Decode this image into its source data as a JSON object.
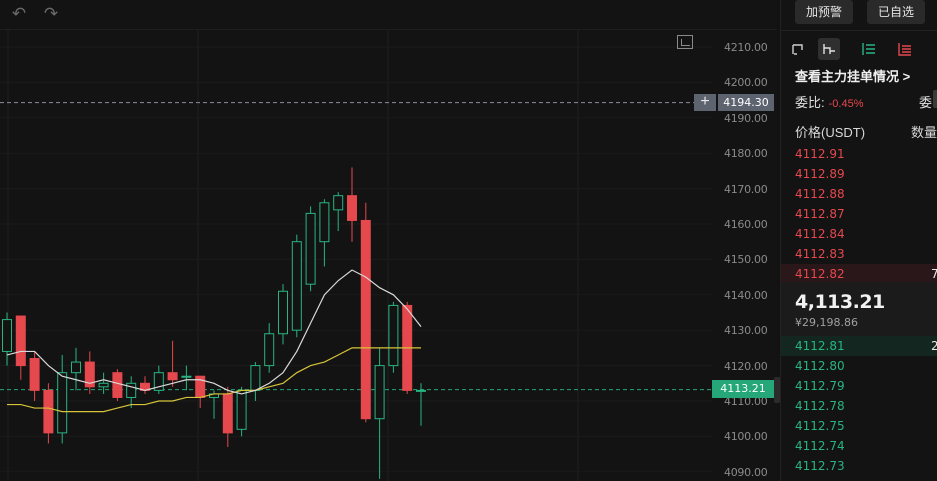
{
  "toolbar": {
    "undo_icon": "undo-icon",
    "redo_icon": "redo-icon",
    "fullscreen_icon": "fullscreen-icon"
  },
  "price_axis": [
    "4210.00",
    "4200.00",
    "4190.00",
    "4180.00",
    "4170.00",
    "4160.00",
    "4150.00",
    "4140.00",
    "4130.00",
    "4120.00",
    "4110.00",
    "4100.00",
    "4090.00"
  ],
  "crosshair": {
    "price": "4194.30",
    "plus_label": "+"
  },
  "last_price_tag": "4113.21",
  "colors": {
    "up": "#28b582",
    "down": "#e5484d",
    "ma_fast": "#d9d9d9",
    "ma_slow": "#d6c43a",
    "price_tag": "#25a779"
  },
  "chart_data": {
    "type": "candlestick",
    "ylim": [
      4087,
      4215
    ],
    "candles": [
      {
        "o": 4124,
        "h": 4135,
        "l": 4120,
        "c": 4133
      },
      {
        "o": 4134,
        "h": 4134,
        "l": 4116,
        "c": 4120
      },
      {
        "o": 4122,
        "h": 4124,
        "l": 4110,
        "c": 4113
      },
      {
        "o": 4113,
        "h": 4115,
        "l": 4098,
        "c": 4101
      },
      {
        "o": 4101,
        "h": 4123,
        "l": 4098,
        "c": 4118
      },
      {
        "o": 4118,
        "h": 4125,
        "l": 4113,
        "c": 4121
      },
      {
        "o": 4121,
        "h": 4124,
        "l": 4112,
        "c": 4114
      },
      {
        "o": 4114,
        "h": 4118,
        "l": 4112,
        "c": 4115
      },
      {
        "o": 4118,
        "h": 4119,
        "l": 4110,
        "c": 4111
      },
      {
        "o": 4111,
        "h": 4117,
        "l": 4108,
        "c": 4115
      },
      {
        "o": 4115,
        "h": 4117,
        "l": 4112,
        "c": 4113
      },
      {
        "o": 4113,
        "h": 4120,
        "l": 4112,
        "c": 4118
      },
      {
        "o": 4118,
        "h": 4127,
        "l": 4114,
        "c": 4116
      },
      {
        "o": 4117,
        "h": 4120,
        "l": 4113,
        "c": 4117
      },
      {
        "o": 4117,
        "h": 4117,
        "l": 4108,
        "c": 4111
      },
      {
        "o": 4111,
        "h": 4113,
        "l": 4105,
        "c": 4112
      },
      {
        "o": 4112,
        "h": 4114,
        "l": 4097,
        "c": 4101
      },
      {
        "o": 4102,
        "h": 4114,
        "l": 4100,
        "c": 4113
      },
      {
        "o": 4113,
        "h": 4121,
        "l": 4110,
        "c": 4120
      },
      {
        "o": 4120,
        "h": 4132,
        "l": 4118,
        "c": 4129
      },
      {
        "o": 4129,
        "h": 4143,
        "l": 4126,
        "c": 4141
      },
      {
        "o": 4130,
        "h": 4157,
        "l": 4128,
        "c": 4155
      },
      {
        "o": 4143,
        "h": 4165,
        "l": 4141,
        "c": 4163
      },
      {
        "o": 4155,
        "h": 4167,
        "l": 4148,
        "c": 4166
      },
      {
        "o": 4164,
        "h": 4169,
        "l": 4158,
        "c": 4168
      },
      {
        "o": 4168,
        "h": 4176,
        "l": 4155,
        "c": 4161
      },
      {
        "o": 4161,
        "h": 4166,
        "l": 4104,
        "c": 4105
      },
      {
        "o": 4105,
        "h": 4125,
        "l": 4088,
        "c": 4120
      },
      {
        "o": 4120,
        "h": 4138,
        "l": 4118,
        "c": 4137
      },
      {
        "o": 4137,
        "h": 4138,
        "l": 4112,
        "c": 4113
      },
      {
        "o": 4113,
        "h": 4115,
        "l": 4103,
        "c": 4113
      }
    ],
    "ma_fast": [
      4123,
      4124,
      4124,
      4120,
      4117,
      4116,
      4115,
      4116,
      4115,
      4114,
      4113,
      4114,
      4115,
      4116,
      4116,
      4115,
      4113,
      4112,
      4113,
      4115,
      4118,
      4124,
      4132,
      4140,
      4144,
      4147,
      4145,
      4142,
      4140,
      4136,
      4131
    ],
    "ma_slow": [
      4109,
      4109,
      4108,
      4108,
      4107,
      4107,
      4107,
      4107,
      4108,
      4109,
      4109,
      4110,
      4110,
      4111,
      4111,
      4112,
      4112,
      4113,
      4113,
      4114,
      4115,
      4118,
      4120,
      4121,
      4123,
      4125,
      4125,
      4125,
      4125,
      4125,
      4125
    ]
  },
  "side_panel": {
    "add_alert": "加预警",
    "added_watchlist": "已自选",
    "view_icons": [
      "orderbook-both-icon",
      "orderbook-depth-icon",
      "orderbook-bids-icon",
      "orderbook-asks-icon"
    ],
    "orderbook_link": "查看主力挂单情况 >",
    "ratio_label": "委比:",
    "ratio_value": "-0.45%",
    "ratio_extra": "委",
    "header_price": "价格(USDT)",
    "header_qty": "数量",
    "asks": [
      {
        "price": "4112.91",
        "qty": ""
      },
      {
        "price": "4112.89",
        "qty": ""
      },
      {
        "price": "4112.88",
        "qty": ""
      },
      {
        "price": "4112.87",
        "qty": ""
      },
      {
        "price": "4112.84",
        "qty": ""
      },
      {
        "price": "4112.83",
        "qty": ""
      },
      {
        "price": "4112.82",
        "qty": "7"
      }
    ],
    "last_price": "4,113.21",
    "last_price_cny": "¥29,198.86",
    "bids": [
      {
        "price": "4112.81",
        "qty": "2"
      },
      {
        "price": "4112.80",
        "qty": ""
      },
      {
        "price": "4112.79",
        "qty": ""
      },
      {
        "price": "4112.78",
        "qty": ""
      },
      {
        "price": "4112.75",
        "qty": ""
      },
      {
        "price": "4112.74",
        "qty": ""
      },
      {
        "price": "4112.73",
        "qty": ""
      }
    ]
  }
}
